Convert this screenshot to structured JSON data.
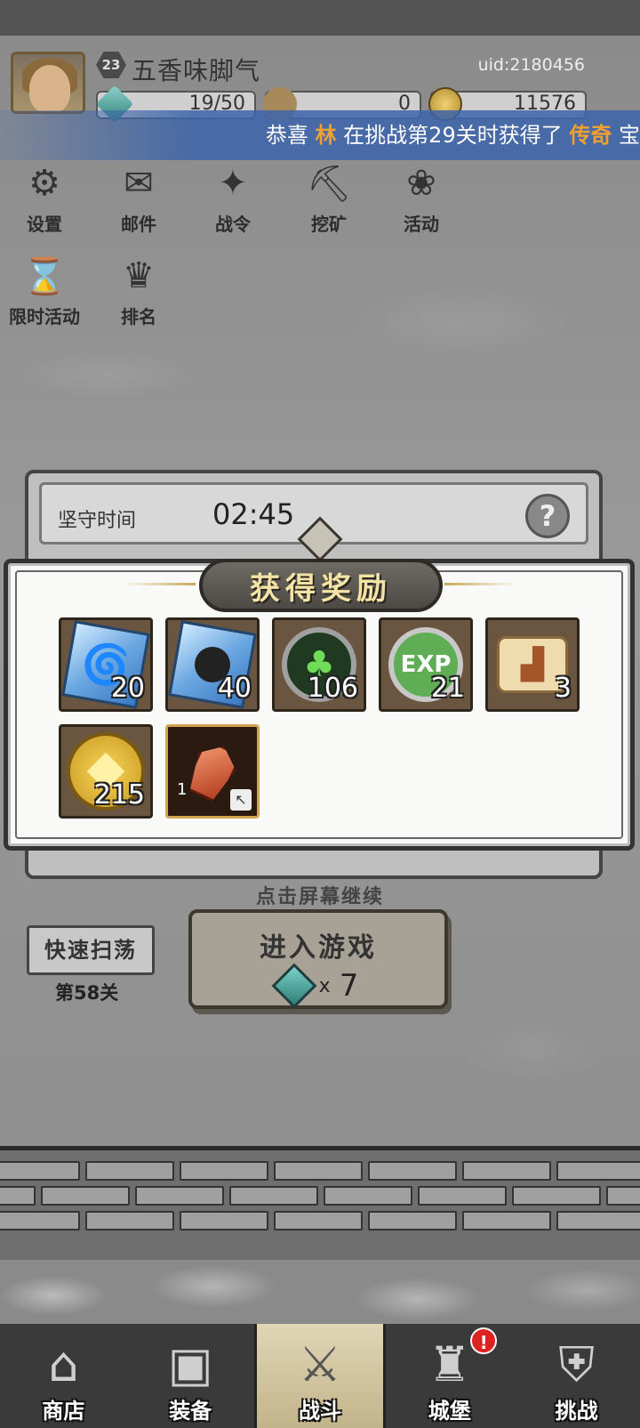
{
  "header": {
    "player_level": "23",
    "player_name": "五香味脚气",
    "uid": "uid:2180456",
    "energy": "19/50",
    "resource_mid": "0",
    "gold": "11576"
  },
  "marquee": {
    "prefix": "恭喜",
    "player": "林",
    "middle": "在挑战第29关时获得了",
    "rarity": "传奇",
    "suffix": "宝"
  },
  "menu": [
    {
      "label": "设置",
      "icon": "gear-icon"
    },
    {
      "label": "邮件",
      "icon": "mail-icon"
    },
    {
      "label": "战令",
      "icon": "battle-pass-icon"
    },
    {
      "label": "挖矿",
      "icon": "mining-icon"
    },
    {
      "label": "活动",
      "icon": "event-icon"
    },
    {
      "label": "限时活动",
      "icon": "limited-event-icon"
    },
    {
      "label": "排名",
      "icon": "ranking-icon"
    }
  ],
  "defense": {
    "label": "坚守时间",
    "time": "02:45"
  },
  "reward": {
    "title": "获得奖励",
    "items": [
      {
        "icon": "tornado-skill-icon",
        "qty": "20"
      },
      {
        "icon": "bomb-skill-icon",
        "qty": "40"
      },
      {
        "icon": "leaf-emblem-icon",
        "qty": "106"
      },
      {
        "icon": "exp-coin-icon",
        "qty": "21",
        "text": "EXP"
      },
      {
        "icon": "boot-scroll-icon",
        "qty": "3"
      },
      {
        "icon": "gold-coin-icon",
        "qty": "215"
      },
      {
        "icon": "red-crystal-icon",
        "qty": "1"
      }
    ]
  },
  "tap_continue": "点击屏幕继续",
  "sweep": {
    "label": "快速扫荡",
    "stage": "第58关"
  },
  "enter_game": {
    "label": "进入游戏",
    "cost_prefix": "x",
    "cost": "7"
  },
  "bottom_nav": [
    {
      "label": "商店",
      "icon": "shop-icon"
    },
    {
      "label": "装备",
      "icon": "backpack-icon"
    },
    {
      "label": "战斗",
      "icon": "crossed-swords-icon"
    },
    {
      "label": "城堡",
      "icon": "castle-icon",
      "badge": "!"
    },
    {
      "label": "挑战",
      "icon": "shield-icon"
    }
  ],
  "colors": {
    "marquee_bg": "#3c64aa",
    "highlight": "#f0a030",
    "title_text": "#f3e3a5"
  }
}
